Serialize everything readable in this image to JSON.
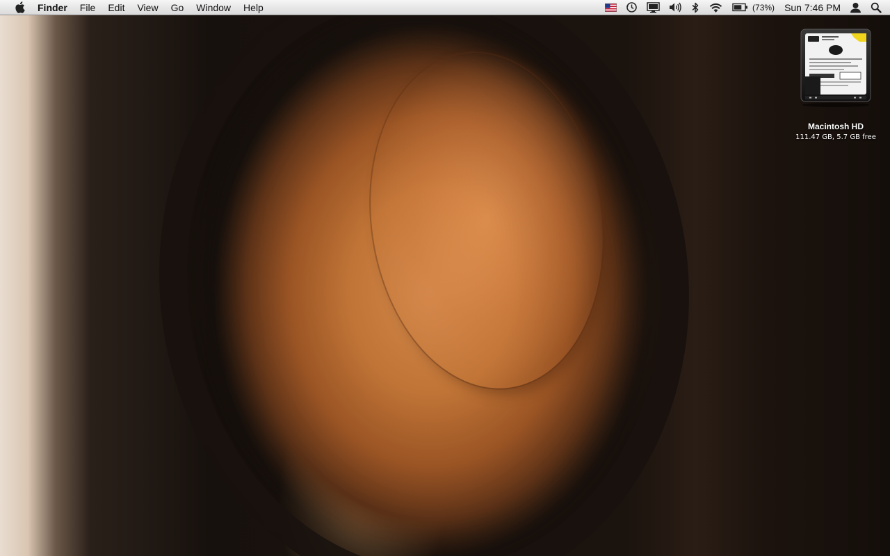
{
  "menubar": {
    "apple_icon": "apple-icon",
    "app_name": "Finder",
    "menus": [
      "File",
      "Edit",
      "View",
      "Go",
      "Window",
      "Help"
    ],
    "extras": {
      "input_source_icon": "us-flag-icon",
      "time_machine_icon": "time-machine-icon",
      "display_icon": "display-icon",
      "volume_icon": "volume-icon",
      "bluetooth_icon": "bluetooth-icon",
      "wifi_icon": "wifi-icon",
      "battery_icon": "battery-icon",
      "battery_percent": "(73%)",
      "battery_level": 0.73,
      "clock": "Sun 7:46 PM",
      "user_icon": "user-icon",
      "spotlight_icon": "spotlight-search-icon"
    }
  },
  "desktop": {
    "icons": [
      {
        "icon": "hard-drive-icon",
        "name": "Macintosh HD",
        "info": "111.47 GB, 5.7 GB free"
      }
    ]
  },
  "colors": {
    "menubar_top": "#f6f6f6",
    "menubar_bottom": "#dadada",
    "wallpaper_orange": "#c07436",
    "wallpaper_dark": "#17110d"
  }
}
